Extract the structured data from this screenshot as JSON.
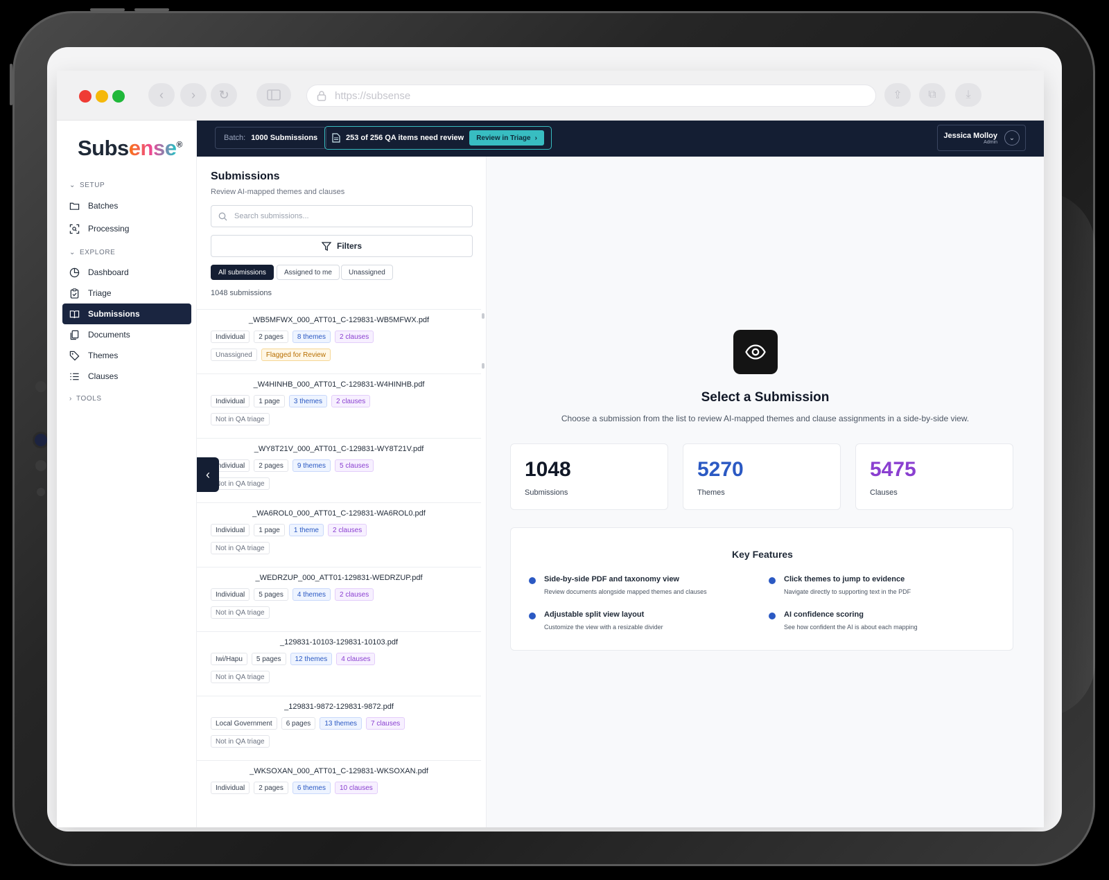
{
  "browser": {
    "url": "https://subsense"
  },
  "sidebar": {
    "logo_a": "Subs",
    "logo_b": "ense",
    "logo_mark": "®",
    "sections": {
      "setup": "SETUP",
      "explore": "EXPLORE",
      "tools": "TOOLS"
    },
    "items": {
      "batches": "Batches",
      "processing": "Processing",
      "dashboard": "Dashboard",
      "triage": "Triage",
      "submissions": "Submissions",
      "documents": "Documents",
      "themes": "Themes",
      "clauses": "Clauses"
    }
  },
  "topbar": {
    "batch_label": "Batch:",
    "batch_value": "1000 Submissions",
    "qa_text": "253 of 256 QA items need review",
    "qa_button": "Review in Triage",
    "user_name": "Jessica Molloy",
    "user_role": "Admin"
  },
  "list": {
    "title": "Submissions",
    "subtitle": "Review AI-mapped themes and clauses",
    "search_placeholder": "Search submissions...",
    "filters_label": "Filters",
    "segments": [
      "All submissions",
      "Assigned to me",
      "Unassigned"
    ],
    "count_label": "1048 submissions",
    "rows": [
      {
        "title": "_WB5MFWX_000_ATT01_C-129831-WB5MFWX.pdf",
        "type": "Individual",
        "pages": "2 pages",
        "themes": "8 themes",
        "clauses": "2 clauses",
        "status": "Unassigned",
        "flag": "Flagged for Review"
      },
      {
        "title": "_W4HINHB_000_ATT01_C-129831-W4HINHB.pdf",
        "type": "Individual",
        "pages": "1 page",
        "themes": "3 themes",
        "clauses": "2 clauses",
        "status": "Not in QA triage"
      },
      {
        "title": "_WY8T21V_000_ATT01_C-129831-WY8T21V.pdf",
        "type": "Individual",
        "pages": "2 pages",
        "themes": "9 themes",
        "clauses": "5 clauses",
        "status": "Not in QA triage"
      },
      {
        "title": "_WA6ROL0_000_ATT01_C-129831-WA6ROL0.pdf",
        "type": "Individual",
        "pages": "1 page",
        "themes": "1 theme",
        "clauses": "2 clauses",
        "status": "Not in QA triage"
      },
      {
        "title": "_WEDRZUP_000_ATT01-129831-WEDRZUP.pdf",
        "type": "Individual",
        "pages": "5 pages",
        "themes": "4 themes",
        "clauses": "2 clauses",
        "status": "Not in QA triage"
      },
      {
        "title": "_129831-10103-129831-10103.pdf",
        "type": "Iwi/Hapu",
        "pages": "5 pages",
        "themes": "12 themes",
        "clauses": "4 clauses",
        "status": "Not in QA triage"
      },
      {
        "title": "_129831-9872-129831-9872.pdf",
        "type": "Local Government",
        "pages": "6 pages",
        "themes": "13 themes",
        "clauses": "7 clauses",
        "status": "Not in QA triage"
      },
      {
        "title": "_WKSOXAN_000_ATT01_C-129831-WKSOXAN.pdf",
        "type": "Individual",
        "pages": "2 pages",
        "themes": "6 themes",
        "clauses": "10 clauses",
        "status": ""
      }
    ]
  },
  "detail": {
    "title": "Select a Submission",
    "subtitle": "Choose a submission from the list to review AI-mapped themes and clause assignments in a side-by-side view.",
    "stats": [
      {
        "value": "1048",
        "label": "Submissions",
        "color": "#111827"
      },
      {
        "value": "5270",
        "label": "Themes",
        "color": "#2b59c3"
      },
      {
        "value": "5475",
        "label": "Clauses",
        "color": "#8a3fd0"
      }
    ],
    "features_title": "Key Features",
    "features": [
      {
        "title": "Side-by-side PDF and taxonomy view",
        "desc": "Review documents alongside mapped themes and clauses"
      },
      {
        "title": "Click themes to jump to evidence",
        "desc": "Navigate directly to supporting text in the PDF"
      },
      {
        "title": "Adjustable split view layout",
        "desc": "Customize the view with a resizable divider"
      },
      {
        "title": "AI confidence scoring",
        "desc": "See how confident the AI is about each mapping"
      }
    ]
  },
  "colors": {
    "navy": "#141e33",
    "teal": "#38bdc1",
    "blue": "#2b59c3",
    "purple": "#8a3fd0"
  }
}
